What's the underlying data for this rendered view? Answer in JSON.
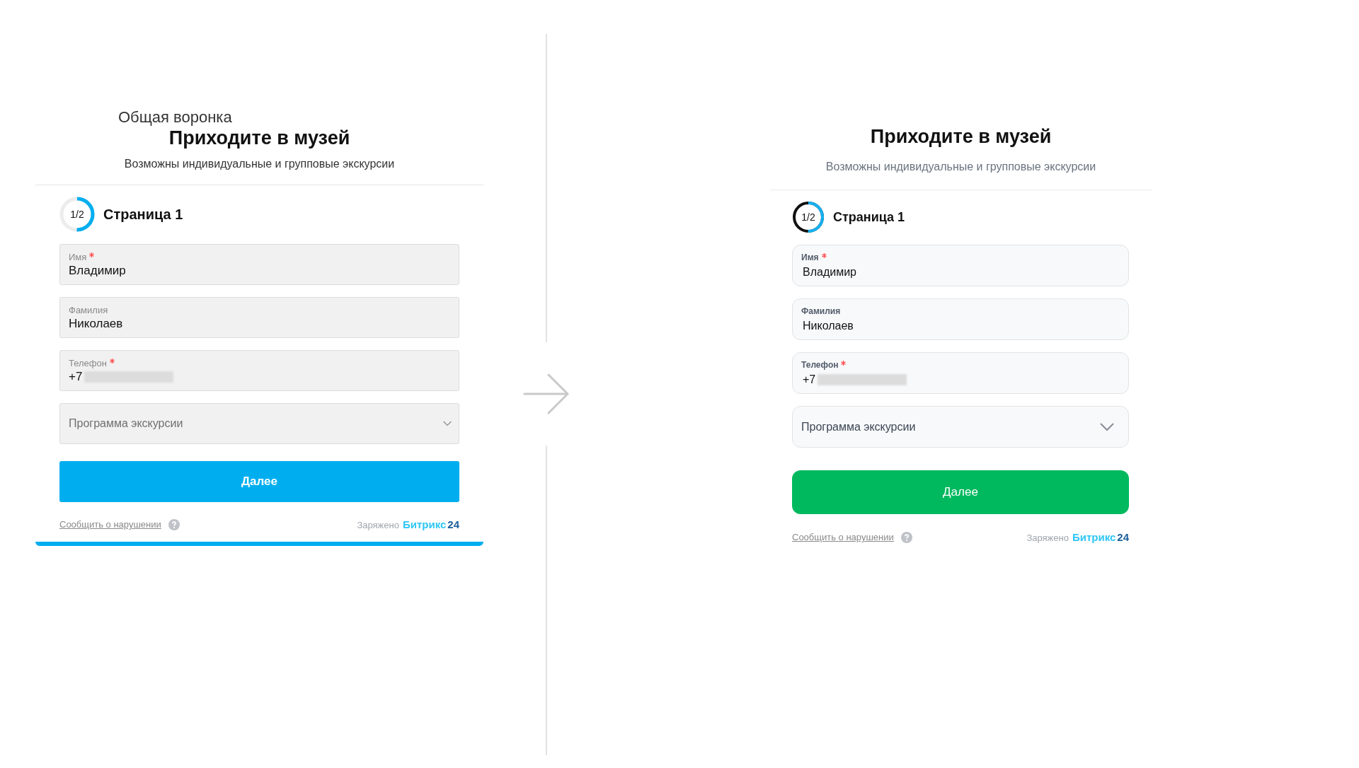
{
  "panels": [
    {
      "funnel_label": "Общая воронка",
      "title": "Приходите в музей",
      "subtitle": "Возможны индивидуальные и групповые экскурсии",
      "step": {
        "label": "1/2"
      },
      "page_title": "Страница 1",
      "fields": [
        {
          "kind": "text",
          "label": "Имя",
          "required": true,
          "value": "Владимир",
          "redacted": false
        },
        {
          "kind": "text",
          "label": "Фамилия",
          "required": false,
          "value": "Николаев",
          "redacted": false
        },
        {
          "kind": "text",
          "label": "Телефон",
          "required": true,
          "value": "+7",
          "redacted": true
        },
        {
          "kind": "select",
          "placeholder": "Программа экскурсии"
        }
      ],
      "button": "Далее",
      "footer": {
        "report_link": "Сообщить о нарушении",
        "powered_prefix": "Заряжено",
        "brand_name": "Битрикс",
        "brand_number": "24"
      }
    },
    {
      "title": "Приходите в музей",
      "subtitle": "Возможны индивидуальные и групповые экскурсии",
      "step": {
        "label": "1/2"
      },
      "page_title": "Страница 1",
      "fields": [
        {
          "kind": "text",
          "label": "Имя",
          "required": true,
          "value": "Владимир",
          "redacted": false
        },
        {
          "kind": "text",
          "label": "Фамилия",
          "required": false,
          "value": "Николаев",
          "redacted": false
        },
        {
          "kind": "text",
          "label": "Телефон",
          "required": true,
          "value": "+7",
          "redacted": true
        },
        {
          "kind": "select",
          "placeholder": "Программа экскурсии"
        }
      ],
      "button": "Далее",
      "footer": {
        "report_link": "Сообщить о нарушении",
        "powered_prefix": "Заряжено",
        "brand_name": "Битрикс",
        "brand_number": "24"
      }
    }
  ]
}
